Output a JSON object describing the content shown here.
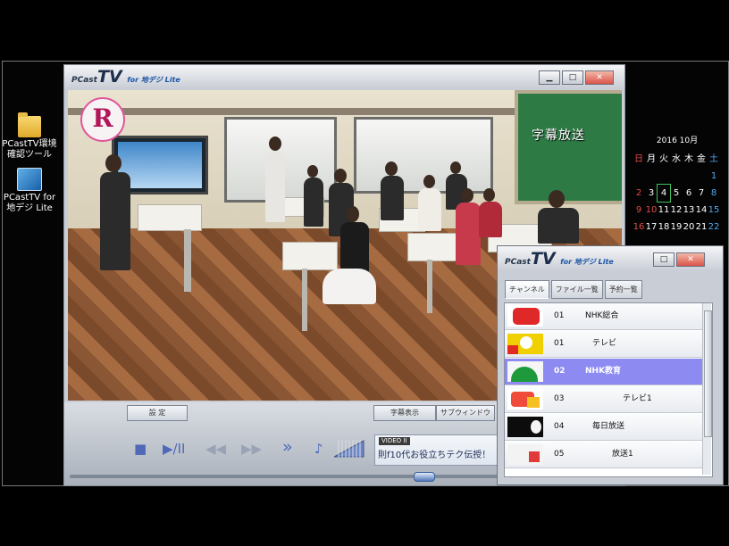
{
  "desktop": {
    "icons": [
      {
        "label": "PCastTV環境確認ツール",
        "icon": "folder-icon"
      },
      {
        "label": "PCastTV for 地デジ Lite",
        "icon": "pcasttv-app-icon"
      }
    ]
  },
  "player": {
    "logo_prefix": "PCast",
    "logo_main": "TV",
    "logo_suffix": "for 地デジ Lite",
    "window_buttons": {
      "minimize": "▁",
      "maximize": "□",
      "close": "✕"
    },
    "video_subtitle_overlay": "字幕放送",
    "settings_label": "設 定",
    "caption_label": "字幕表示",
    "surround_label": "サブウィンドウ",
    "controls": {
      "stop": "■",
      "play_pause": "▶/II",
      "rewind": "◀◀",
      "forward": "▶▶",
      "skip": "»",
      "mute": "♪"
    },
    "video_tag": "VIDEO II",
    "program_title": "則f10代お役立ちテク伝授！"
  },
  "calendar": {
    "month_label": "2016 10月",
    "weekdays": [
      "日",
      "月",
      "火",
      "水",
      "木",
      "金",
      "土"
    ],
    "weeks": [
      [
        "",
        "",
        "",
        "",
        "",
        "",
        "1"
      ],
      [
        "2",
        "3",
        "4",
        "5",
        "6",
        "7",
        "8"
      ],
      [
        "9",
        "10",
        "11",
        "12",
        "13",
        "14",
        "15"
      ],
      [
        "16",
        "17",
        "18",
        "19",
        "20",
        "21",
        "22"
      ]
    ],
    "today": "4"
  },
  "channel_window": {
    "logo_prefix": "PCast",
    "logo_main": "TV",
    "logo_suffix": "for 地デジ Lite",
    "tabs": [
      "チャンネル",
      "ファイル一覧",
      "予約一覧"
    ],
    "selected_tab": "チャンネル",
    "channels": [
      {
        "num": "01",
        "name": "NHK総合",
        "selected": false,
        "thumb_color": "#e02828"
      },
      {
        "num": "01",
        "name": "テレビ",
        "selected": false,
        "thumb_color": "#f0d000"
      },
      {
        "num": "02",
        "name": "NHK教育",
        "selected": true,
        "thumb_color": "#1e9a3c"
      },
      {
        "num": "03",
        "name": "テレビ1",
        "selected": false,
        "thumb_color": "#f04a3a"
      },
      {
        "num": "04",
        "name": "毎日放送",
        "selected": false,
        "thumb_color": "#111111"
      },
      {
        "num": "05",
        "name": "放送1",
        "selected": false,
        "thumb_color": "#e23a3a"
      }
    ]
  }
}
